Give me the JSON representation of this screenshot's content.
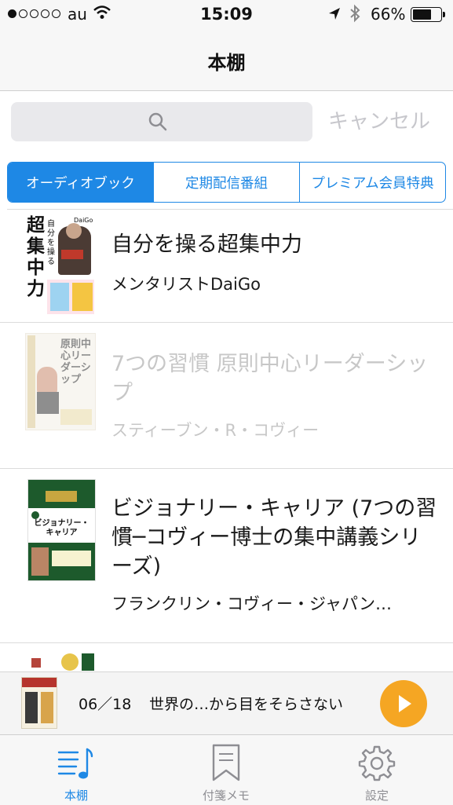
{
  "status_bar": {
    "carrier": "au",
    "time": "15:09",
    "battery_pct": "66%",
    "signal_bars": 1
  },
  "nav": {
    "title": "本棚"
  },
  "search": {
    "placeholder": "",
    "cancel_label": "キャンセル"
  },
  "segments": [
    "オーディオブック",
    "定期配信番組",
    "プレミアム会員特典"
  ],
  "selected_segment": 0,
  "books": [
    {
      "title": "自分を操る超集中力",
      "author": "メンタリストDaiGo",
      "dimmed": false
    },
    {
      "title": "7つの習慣 原則中心リーダーシップ",
      "author": "スティーブン・R・コヴィー",
      "dimmed": true
    },
    {
      "title": "ビジョナリー・キャリア (7つの習慣─コヴィー博士の集中講義シリーズ)",
      "author": "フランクリン・コヴィー・ジャパン…",
      "dimmed": false
    }
  ],
  "player": {
    "episode": "06／18",
    "title": "世界の…から目をそらさない",
    "accent": "#f5a623"
  },
  "tabs": [
    {
      "label": "本棚",
      "icon": "bookshelf-music-icon"
    },
    {
      "label": "付箋メモ",
      "icon": "bookmark-icon"
    },
    {
      "label": "設定",
      "icon": "gear-icon"
    }
  ],
  "accent": "#1e88e5"
}
